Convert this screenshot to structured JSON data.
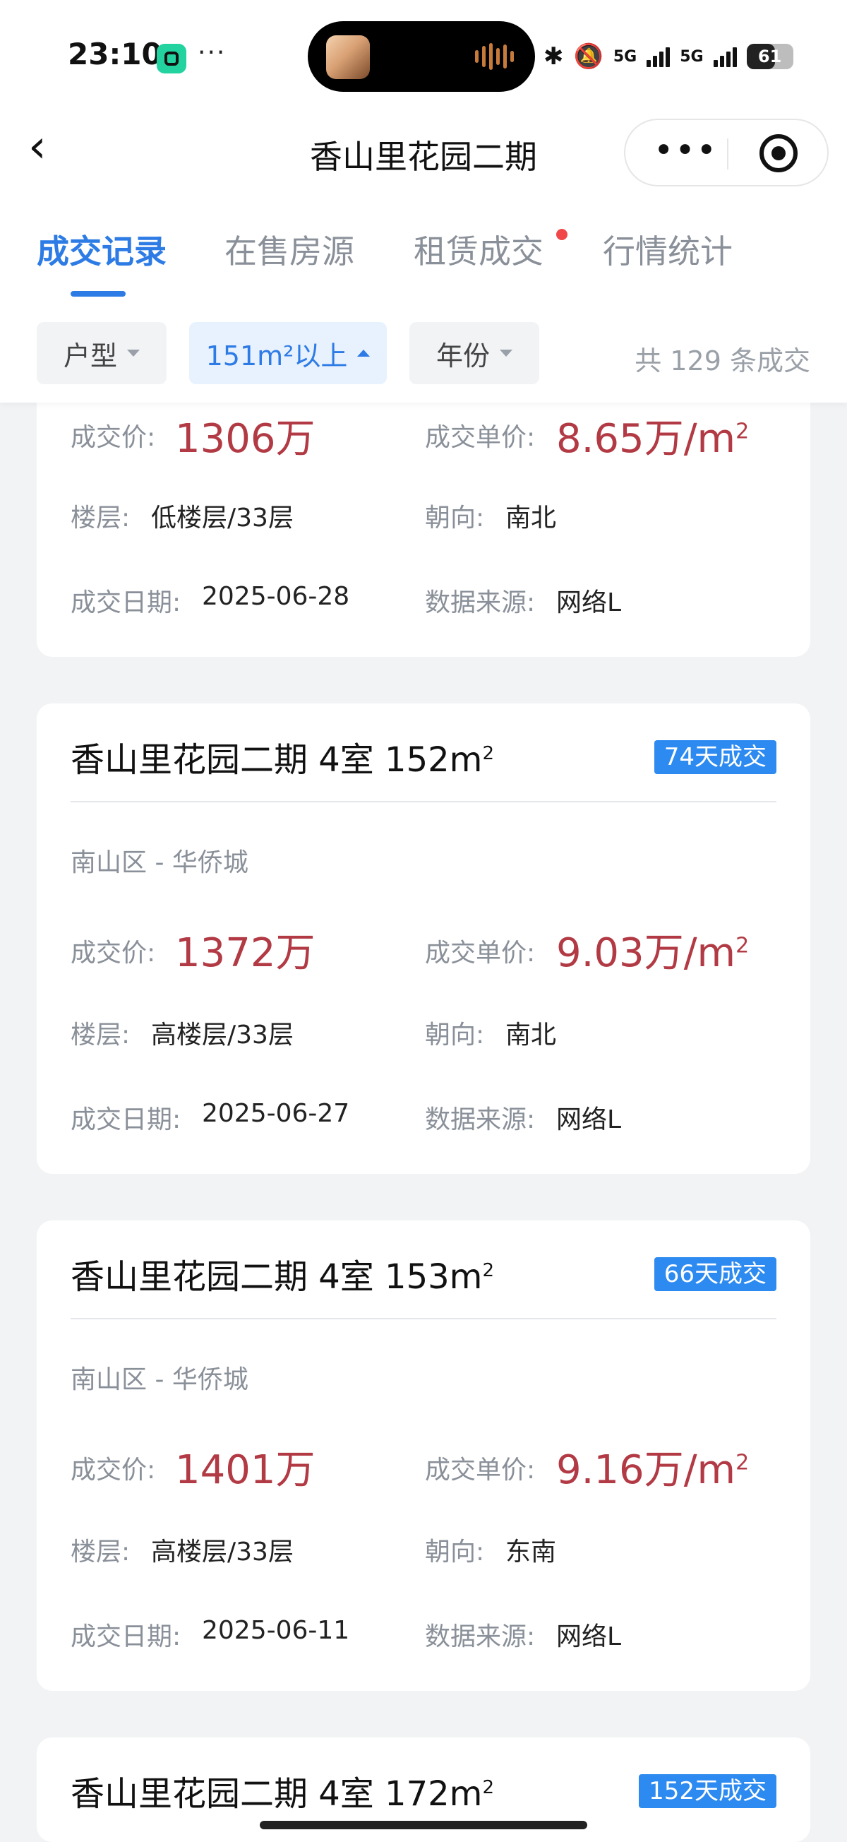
{
  "status_bar": {
    "time": "23:10",
    "more": "···",
    "network_1": "5G",
    "network_2": "5G",
    "battery": "61",
    "battery_level": 0.61,
    "icons": [
      "bluetooth-icon",
      "mute-icon",
      "signal-icon",
      "battery-icon"
    ]
  },
  "nav": {
    "title": "香山里花园二期",
    "more": "•••"
  },
  "tabs": [
    {
      "label": "成交记录",
      "active": true
    },
    {
      "label": "在售房源",
      "active": false
    },
    {
      "label": "租赁成交",
      "active": false,
      "dot": true
    },
    {
      "label": "行情统计",
      "active": false
    }
  ],
  "filters": {
    "type": "户型",
    "area": "151m²以上",
    "year": "年份",
    "total": "共 129 条成交"
  },
  "labels": {
    "price": "成交价:",
    "unit_price": "成交单价:",
    "floor": "楼层:",
    "orientation": "朝向:",
    "date": "成交日期:",
    "source": "数据来源:"
  },
  "records": [
    {
      "price": "1306万",
      "unit_price": "8.65万/m",
      "floor": "低楼层/33层",
      "orientation": "南北",
      "date": "2025-06-28",
      "source": "网络L"
    },
    {
      "title": "香山里花园二期 4室 152m",
      "badge": "74天成交",
      "district": "南山区 - 华侨城",
      "price": "1372万",
      "unit_price": "9.03万/m",
      "floor": "高楼层/33层",
      "orientation": "南北",
      "date": "2025-06-27",
      "source": "网络L"
    },
    {
      "title": "香山里花园二期 4室 153m",
      "badge": "66天成交",
      "district": "南山区 - 华侨城",
      "price": "1401万",
      "unit_price": "9.16万/m",
      "floor": "高楼层/33层",
      "orientation": "东南",
      "date": "2025-06-11",
      "source": "网络L"
    },
    {
      "title": "香山里花园二期 4室 172m",
      "badge": "152天成交"
    }
  ],
  "colors": {
    "accent": "#2d7be5",
    "price": "#b23a44",
    "badge": "#2d8af0",
    "background": "#f2f3f5"
  }
}
